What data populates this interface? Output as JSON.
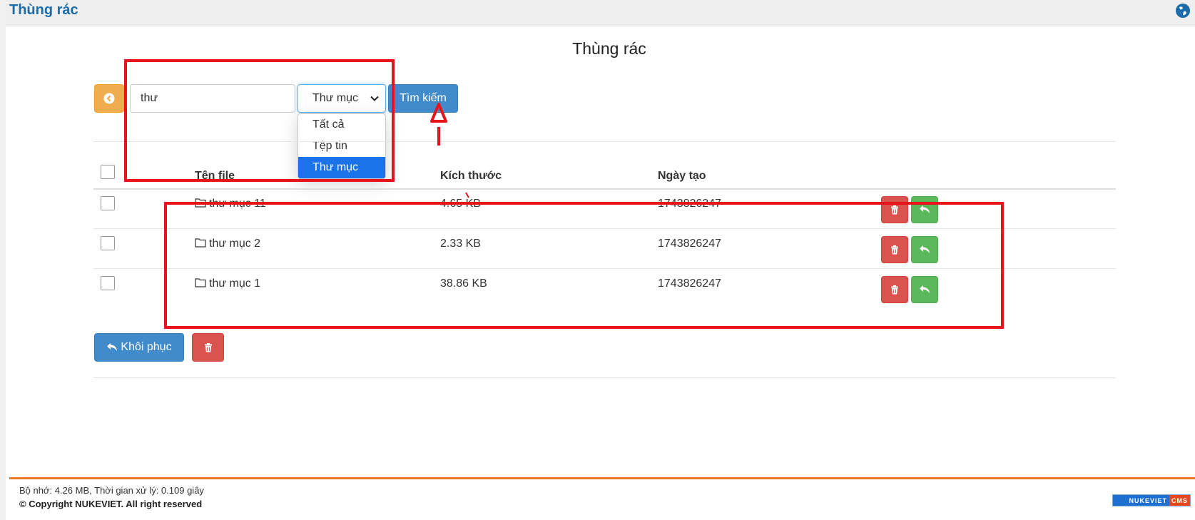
{
  "header": {
    "title": "Thùng rác"
  },
  "page": {
    "title": "Thùng rác"
  },
  "search": {
    "query": "thư",
    "type_selected": "Thư mục",
    "type_options": [
      "Tất cả",
      "Tệp tin",
      "Thư mục"
    ],
    "button_label": "Tìm kiếm"
  },
  "table": {
    "columns": {
      "name": "Tên file",
      "size": "Kích thước",
      "created": "Ngày tạo"
    },
    "rows": [
      {
        "name": "thư mục 11",
        "size": "4.65 KB",
        "created": "1743826247"
      },
      {
        "name": "thư mục 2",
        "size": "2.33 KB",
        "created": "1743826247"
      },
      {
        "name": "thư mục 1",
        "size": "38.86 KB",
        "created": "1743826247"
      }
    ]
  },
  "actions": {
    "restore_all_label": "Khôi phục"
  },
  "footer": {
    "stats": "Bộ nhớ: 4.26 MB, Thời gian xử lý: 0.109 giây",
    "copyright": "© Copyright NUKEVIET. All right reserved",
    "logo_text": "NUKEVIET",
    "logo_badge": "CMS"
  },
  "colors": {
    "primary": "#428bca",
    "danger": "#d9534f",
    "success": "#5cb85c",
    "warning": "#f0ad4e",
    "accent_footer": "#f07722",
    "annotation": "#e8141c"
  }
}
